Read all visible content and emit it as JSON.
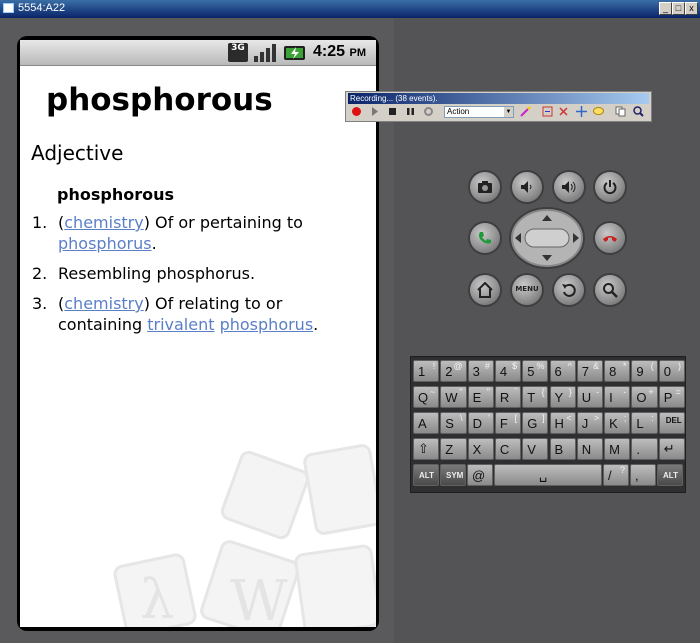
{
  "window": {
    "title": "5554:A22",
    "minimize": "_",
    "restore": "□",
    "close": "x"
  },
  "status_bar": {
    "network": "3G",
    "time": "4:25",
    "ampm": "PM"
  },
  "entry": {
    "word": "phosphorous",
    "part_of_speech": "Adjective",
    "headword": "phosphorous",
    "definitions": [
      {
        "num": "1.",
        "pre": "(",
        "link1": "chemistry",
        "mid": ") Of or pertaining to ",
        "link2": "phosphorus",
        "end": "."
      },
      {
        "num": "2.",
        "text": "Resembling phosphorus."
      },
      {
        "num": "3.",
        "pre": "(",
        "link1": "chemistry",
        "mid": ") Of relating to or containing ",
        "link2": "trivalent",
        "sp": " ",
        "link3": "phosphorus",
        "end": "."
      }
    ]
  },
  "recorder": {
    "title": "Recording... (38 events).",
    "action_select": "Action"
  },
  "controls": {
    "menu_label": "MENU"
  },
  "keyboard": {
    "row1": [
      [
        "1",
        "!"
      ],
      [
        "2",
        "@"
      ],
      [
        "3",
        "#"
      ],
      [
        "4",
        "$"
      ],
      [
        "5",
        "%"
      ],
      [
        "6",
        "^"
      ],
      [
        "7",
        "&"
      ],
      [
        "8",
        "*"
      ],
      [
        "9",
        "("
      ],
      [
        "0",
        ")"
      ]
    ],
    "row2": [
      [
        "Q",
        "~"
      ],
      [
        "W",
        "\""
      ],
      [
        "E",
        "\""
      ],
      [
        "R",
        "`"
      ],
      [
        "T",
        "{"
      ],
      [
        "Y",
        "}"
      ],
      [
        "U",
        "-"
      ],
      [
        "I",
        "-"
      ],
      [
        "O",
        "+"
      ],
      [
        "P",
        "="
      ]
    ],
    "row3": [
      [
        "A",
        ""
      ],
      [
        "S",
        "\\"
      ],
      [
        "D",
        "'"
      ],
      [
        "F",
        "["
      ],
      [
        "G",
        "]"
      ],
      [
        "H",
        "<"
      ],
      [
        "J",
        ">"
      ],
      [
        "K",
        ";"
      ],
      [
        "L",
        ":"
      ],
      [
        "DEL",
        ""
      ]
    ],
    "row4": [
      [
        "⇧",
        ""
      ],
      [
        "Z",
        ""
      ],
      [
        "X",
        ""
      ],
      [
        "C",
        ""
      ],
      [
        "V",
        ""
      ],
      [
        "B",
        ""
      ],
      [
        "N",
        ""
      ],
      [
        "M",
        ""
      ],
      [
        ".",
        ""
      ],
      [
        "↵",
        ""
      ]
    ],
    "row5": {
      "alt": "ALT",
      "sym": "SYM",
      "at": "@",
      "space": "␣",
      "slash": "/",
      "question": "?",
      "comma": ",",
      "alt2": "ALT"
    }
  },
  "colors": {
    "link": "#5b7fc7",
    "skin": "#545456",
    "titlebar": "#0a246a"
  }
}
